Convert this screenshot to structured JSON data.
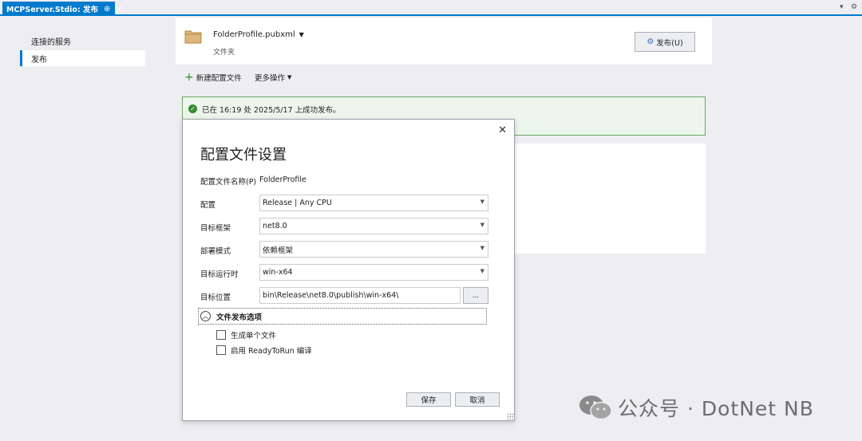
{
  "tab": {
    "title": "MCPServer.Stdio: 发布",
    "pin": "⊕",
    "close": "✕"
  },
  "tabstrip_controls": {
    "dropdown": "▾",
    "settings": "⚙"
  },
  "nav": {
    "items": [
      {
        "label": "连接的服务",
        "selected": false
      },
      {
        "label": "发布",
        "selected": true
      }
    ]
  },
  "profile": {
    "name": "FolderProfile.pubxml",
    "type": "文件夹",
    "publish_button": "发布(U)"
  },
  "actions": {
    "new_profile": "新建配置文件",
    "more_actions": "更多操作"
  },
  "banner": {
    "message": "已在 16:19 处 2025/5/17 上成功发布。"
  },
  "dialog": {
    "title": "配置文件设置",
    "close": "✕",
    "profile_name_label": "配置文件名称(P)",
    "profile_name_value": "FolderProfile",
    "config_label": "配置",
    "config_value": "Release | Any CPU",
    "framework_label": "目标框架",
    "framework_value": "net8.0",
    "deploy_label": "部署模式",
    "deploy_value": "依赖框架",
    "runtime_label": "目标运行时",
    "runtime_value": "win-x64",
    "location_label": "目标位置",
    "location_value": "bin\\Release\\net8.0\\publish\\win-x64\\",
    "browse_label": "...",
    "options_header": "文件发布选项",
    "options": [
      {
        "label": "生成单个文件",
        "checked": false
      },
      {
        "label": "启用 ReadyToRun 编译",
        "checked": false
      }
    ],
    "save": "保存",
    "cancel": "取消"
  },
  "watermark": {
    "text": "公众号 · DotNet NB"
  },
  "colors": {
    "accent": "#007acc",
    "success": "#388a34",
    "success_bg": "#edf6ec",
    "folder": "#dcb67a"
  }
}
